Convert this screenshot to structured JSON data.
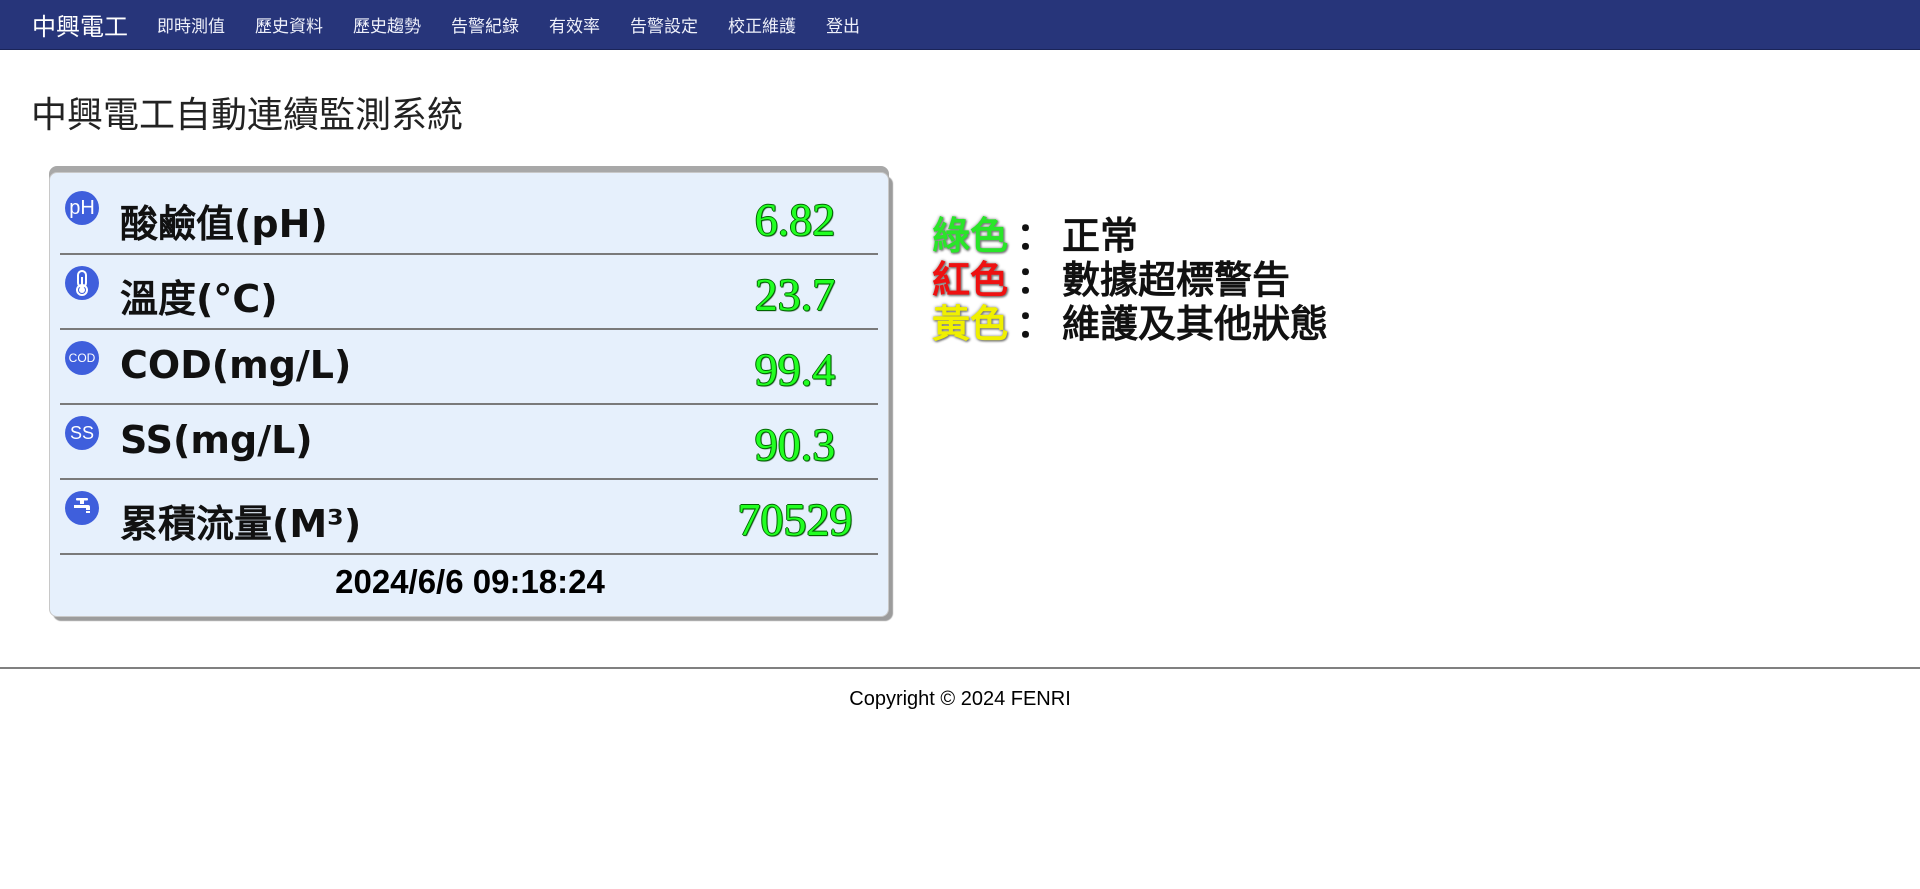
{
  "nav": {
    "brand": "中興電工",
    "items": [
      "即時測值",
      "歷史資料",
      "歷史趨勢",
      "告警紀錄",
      "有效率",
      "告警設定",
      "校正維護",
      "登出"
    ]
  },
  "page": {
    "title": "中興電工自動連續監測系統"
  },
  "panel": {
    "rows": [
      {
        "icon": "ph-icon",
        "icon_text": "pH",
        "label": "酸鹼值(pH)",
        "value": "6.82"
      },
      {
        "icon": "thermometer-icon",
        "icon_text": "",
        "label": "溫度(°C)",
        "value": "23.7"
      },
      {
        "icon": "cod-icon",
        "icon_text": "COD",
        "label": "COD(mg/L)",
        "value": "99.4"
      },
      {
        "icon": "ss-icon",
        "icon_text": "SS",
        "label": "SS(mg/L)",
        "value": "90.3"
      },
      {
        "icon": "faucet-icon",
        "icon_text": "",
        "label": "累積流量(M³)",
        "value": "70529"
      }
    ],
    "timestamp": "2024/6/6 09:18:24"
  },
  "legend": [
    {
      "color_name": "綠色",
      "separator": "：",
      "description": "正常",
      "color": "#29e629"
    },
    {
      "color_name": "紅色",
      "separator": "：",
      "description": "數據超標警告",
      "color": "#ee1111"
    },
    {
      "color_name": "黃色",
      "separator": "：",
      "description": "維護及其他狀態",
      "color": "#f0f000"
    }
  ],
  "colors": {
    "navbar": "#27357a",
    "value_ok": "#22ff22",
    "icon_bg": "#3f5fdc",
    "panel_bg": "#e6f0fc"
  },
  "footer": {
    "copyright": "Copyright © 2024 FENRI"
  }
}
